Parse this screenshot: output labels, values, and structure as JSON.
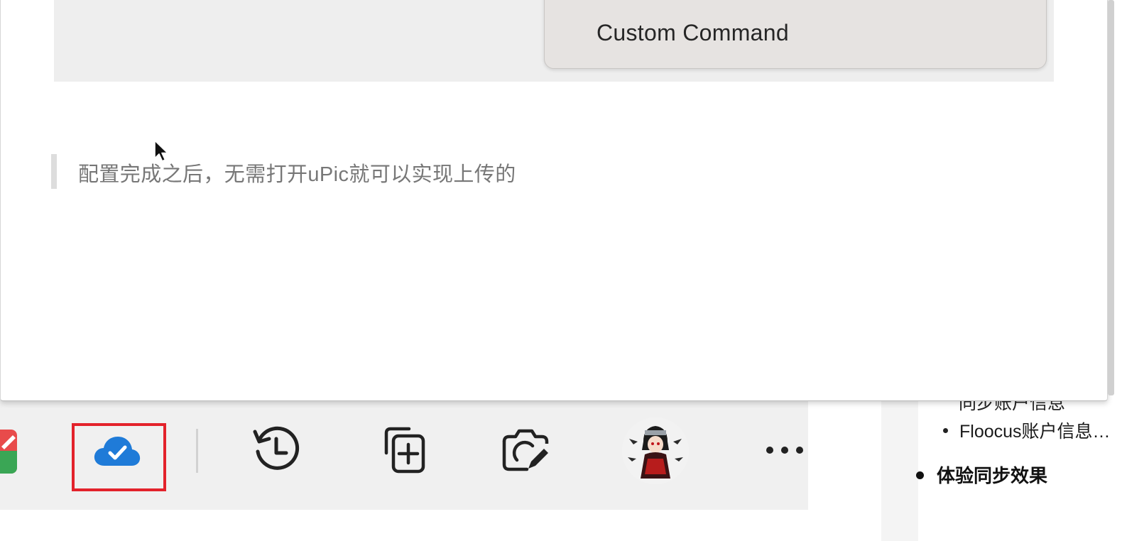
{
  "context_menu": {
    "item_label": "Custom Command"
  },
  "editor": {
    "blockquote_text": "配置完成之后，无需打开uPic就可以实现上传的"
  },
  "toolbar": {
    "items": [
      {
        "icon": "cloud-check-icon",
        "state": "highlighted",
        "accent": "#1f7bd8"
      },
      {
        "icon": "history-icon"
      },
      {
        "icon": "collection-add-icon"
      },
      {
        "icon": "screenshot-capture-icon"
      },
      {
        "icon": "profile-avatar"
      },
      {
        "icon": "more-icon"
      }
    ],
    "highlight_color": "#e3222b"
  },
  "outline": {
    "cut_item": "同步账户信息",
    "item_floocus": "Floocus账户信息…",
    "item_sync_effect": "体验同步效果"
  }
}
